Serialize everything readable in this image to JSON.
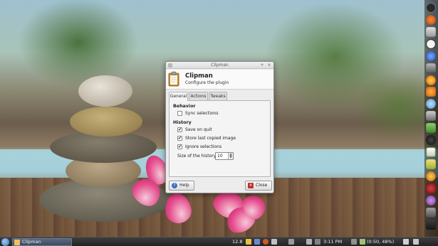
{
  "dialog": {
    "window_title": "Clipman",
    "app_name": "Clipman",
    "app_subtitle": "Configure the plugin",
    "tabs": [
      {
        "label": "General",
        "active": true
      },
      {
        "label": "Actions",
        "active": false
      },
      {
        "label": "Tweaks",
        "active": false
      }
    ],
    "behavior": {
      "heading": "Behavior",
      "sync_selections": {
        "label": "Sync selections",
        "checked": false
      }
    },
    "history": {
      "heading": "History",
      "save_on_quit": {
        "label": "Save on quit",
        "checked": true
      },
      "store_last_image": {
        "label": "Store last copied image",
        "checked": true
      },
      "ignore_selections": {
        "label": "Ignore selections",
        "checked": true
      },
      "size_label": "Size of the history:",
      "size_value": "10"
    },
    "help_label": "Help",
    "close_label": "Close"
  },
  "taskbar": {
    "window_button_label": "Clipman",
    "left_tray_text": "12.8",
    "clock": "3:11 PM",
    "battery": "(0:50, 48%)"
  },
  "colors": {
    "accent": "#3a78c0",
    "help_icon": "#3b6fc2",
    "close_icon": "#c03030"
  }
}
